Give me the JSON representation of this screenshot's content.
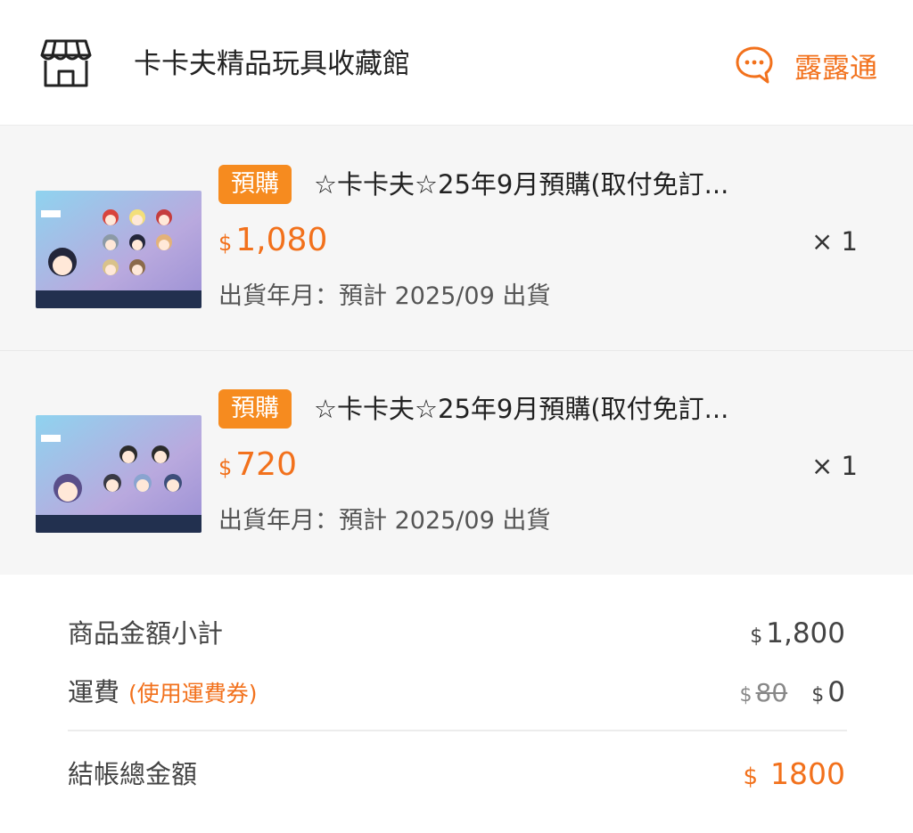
{
  "header": {
    "store_icon": "store-icon",
    "store_name": "卡卡夫精品玩具收藏館",
    "chat_icon": "chat-bubble-icon",
    "chat_label": "露露通"
  },
  "items": [
    {
      "badge": "預購",
      "title": "☆卡卡夫☆25年9月預購(取付免訂...",
      "currency": "$",
      "price": "1,080",
      "quantity": "× 1",
      "ship_date": "出貨年月：預計 2025/09 出貨"
    },
    {
      "badge": "預購",
      "title": "☆卡卡夫☆25年9月預購(取付免訂...",
      "currency": "$",
      "price": "720",
      "quantity": "× 1",
      "ship_date": "出貨年月：預計 2025/09 出貨"
    }
  ],
  "summary": {
    "subtotal_label": "商品金額小計",
    "subtotal_currency": "$",
    "subtotal_value": "1,800",
    "shipping_label": "運費",
    "shipping_note": "(使用運費券)",
    "shipping_original_currency": "$",
    "shipping_original": "80",
    "shipping_currency": "$",
    "shipping_value": "0",
    "total_label": "結帳總金額",
    "total_currency": "$",
    "total_value": "1800"
  },
  "colors": {
    "accent": "#f2711c",
    "badge": "#f68b1f"
  }
}
